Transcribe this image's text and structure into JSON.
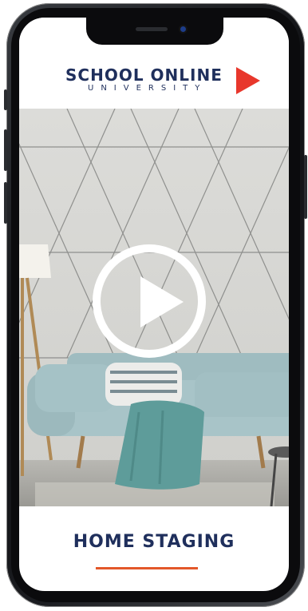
{
  "app": {
    "logo_main": "SCHOOL ONLINE",
    "logo_sub": "UNIVERSITY"
  },
  "video": {
    "play_icon": "play-icon",
    "scene": "living-room-sofa"
  },
  "content": {
    "title": "HOME STAGING"
  },
  "colors": {
    "brand_navy": "#1f2f5c",
    "brand_red": "#e8372c",
    "accent_orange": "#e3572a"
  }
}
